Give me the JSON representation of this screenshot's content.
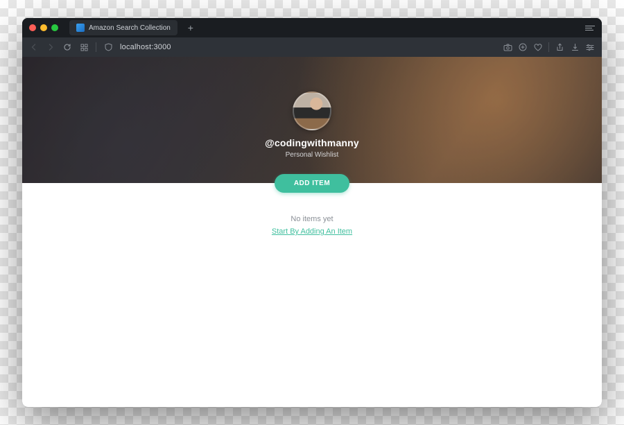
{
  "browser": {
    "tab_title": "Amazon Search Collection",
    "url": "localhost:3000"
  },
  "profile": {
    "handle": "@codingwithmanny",
    "subtitle": "Personal Wishlist"
  },
  "actions": {
    "add_item_label": "ADD ITEM"
  },
  "empty": {
    "message": "No items yet",
    "link_label": "Start By Adding An Item"
  }
}
